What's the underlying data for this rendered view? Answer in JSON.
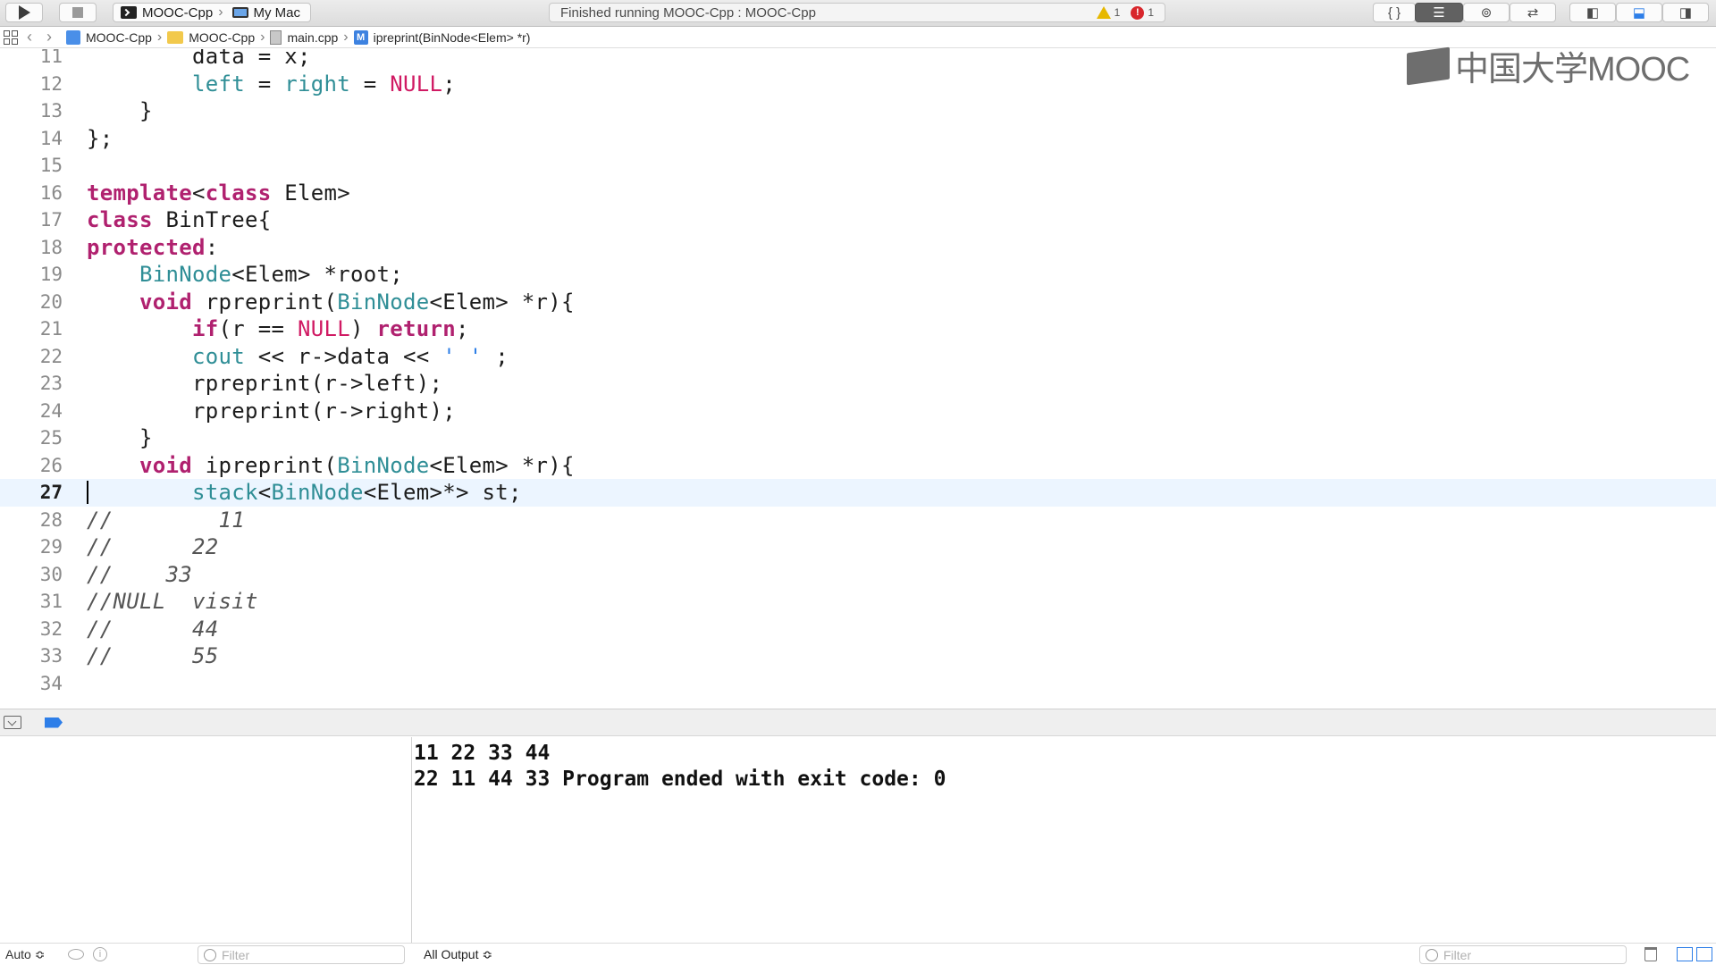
{
  "toolbar": {
    "scheme_target": "MOOC-Cpp",
    "scheme_device": "My Mac",
    "activity_status": "Finished running MOOC-Cpp : MOOC-Cpp",
    "warning_count": "1",
    "error_count": "1",
    "brace_label": "{ }",
    "warning_color": "#e6b800",
    "error_color": "#d8262c"
  },
  "jumpbar": {
    "crumbs": [
      "MOOC-Cpp",
      "MOOC-Cpp",
      "main.cpp",
      "ipreprint(BinNode<Elem> *r)"
    ]
  },
  "watermark": {
    "text": "中国大学MOOC"
  },
  "editor": {
    "current_line": "27",
    "lines": [
      {
        "n": "11",
        "t": [
          {
            "c": "        data = x;",
            "k": "id"
          }
        ]
      },
      {
        "n": "12",
        "t": [
          {
            "c": "        ",
            "k": "id"
          },
          {
            "c": "left",
            "k": "ty"
          },
          {
            "c": " = ",
            "k": "id"
          },
          {
            "c": "right",
            "k": "ty"
          },
          {
            "c": " = ",
            "k": "id"
          },
          {
            "c": "NULL",
            "k": "mac"
          },
          {
            "c": ";",
            "k": "id"
          }
        ]
      },
      {
        "n": "13",
        "t": [
          {
            "c": "    }",
            "k": "id"
          }
        ]
      },
      {
        "n": "14",
        "t": [
          {
            "c": "};",
            "k": "id"
          }
        ]
      },
      {
        "n": "15",
        "t": [
          {
            "c": "",
            "k": "id"
          }
        ]
      },
      {
        "n": "16",
        "t": [
          {
            "c": "template",
            "k": "kw"
          },
          {
            "c": "<",
            "k": "id"
          },
          {
            "c": "class",
            "k": "kw"
          },
          {
            "c": " Elem>",
            "k": "id"
          }
        ]
      },
      {
        "n": "17",
        "t": [
          {
            "c": "class",
            "k": "kw"
          },
          {
            "c": " BinTree{",
            "k": "id"
          }
        ]
      },
      {
        "n": "18",
        "t": [
          {
            "c": "protected",
            "k": "kw"
          },
          {
            "c": ":",
            "k": "id"
          }
        ]
      },
      {
        "n": "19",
        "t": [
          {
            "c": "    ",
            "k": "id"
          },
          {
            "c": "BinNode",
            "k": "ty"
          },
          {
            "c": "<Elem> *root;",
            "k": "id"
          }
        ]
      },
      {
        "n": "20",
        "t": [
          {
            "c": "    ",
            "k": "id"
          },
          {
            "c": "void",
            "k": "kw"
          },
          {
            "c": " rpreprint(",
            "k": "id"
          },
          {
            "c": "BinNode",
            "k": "ty"
          },
          {
            "c": "<Elem> *r){",
            "k": "id"
          }
        ]
      },
      {
        "n": "21",
        "t": [
          {
            "c": "        ",
            "k": "id"
          },
          {
            "c": "if",
            "k": "kw"
          },
          {
            "c": "(r == ",
            "k": "id"
          },
          {
            "c": "NULL",
            "k": "mac"
          },
          {
            "c": ") ",
            "k": "id"
          },
          {
            "c": "return",
            "k": "kw"
          },
          {
            "c": ";",
            "k": "id"
          }
        ]
      },
      {
        "n": "22",
        "t": [
          {
            "c": "        ",
            "k": "id"
          },
          {
            "c": "cout",
            "k": "ty"
          },
          {
            "c": " << r->data << ",
            "k": "id"
          },
          {
            "c": "' '",
            "k": "str"
          },
          {
            "c": " ;",
            "k": "id"
          }
        ]
      },
      {
        "n": "23",
        "t": [
          {
            "c": "        rpreprint(r->left);",
            "k": "id"
          }
        ]
      },
      {
        "n": "24",
        "t": [
          {
            "c": "        rpreprint(r->right);",
            "k": "id"
          }
        ]
      },
      {
        "n": "25",
        "t": [
          {
            "c": "    }",
            "k": "id"
          }
        ]
      },
      {
        "n": "26",
        "t": [
          {
            "c": "    ",
            "k": "id"
          },
          {
            "c": "void",
            "k": "kw"
          },
          {
            "c": " ipreprint(",
            "k": "id"
          },
          {
            "c": "BinNode",
            "k": "ty"
          },
          {
            "c": "<Elem> *r){",
            "k": "id"
          }
        ]
      },
      {
        "n": "27",
        "t": [
          {
            "c": "        ",
            "k": "id"
          },
          {
            "c": "stack",
            "k": "ty"
          },
          {
            "c": "<",
            "k": "id"
          },
          {
            "c": "BinNode",
            "k": "ty"
          },
          {
            "c": "<Elem>*> st;",
            "k": "id"
          }
        ]
      },
      {
        "n": "28",
        "t": [
          {
            "c": "//        11",
            "k": "cm"
          }
        ]
      },
      {
        "n": "29",
        "t": [
          {
            "c": "//      22",
            "k": "cm"
          }
        ]
      },
      {
        "n": "30",
        "t": [
          {
            "c": "//    33",
            "k": "cm"
          }
        ]
      },
      {
        "n": "31",
        "t": [
          {
            "c": "//NULL  visit",
            "k": "cm"
          }
        ]
      },
      {
        "n": "32",
        "t": [
          {
            "c": "//      44",
            "k": "cm"
          }
        ]
      },
      {
        "n": "33",
        "t": [
          {
            "c": "//      55",
            "k": "cm"
          }
        ]
      },
      {
        "n": "34",
        "t": [
          {
            "c": "",
            "k": "id"
          }
        ]
      }
    ]
  },
  "console": {
    "lines": [
      "11 22 33 44",
      "22 11 44 33 Program ended with exit code: 0"
    ]
  },
  "bottom": {
    "auto_label": "Auto ≎",
    "filter_placeholder": "Filter",
    "output_label": "All Output ≎",
    "filter2_placeholder": "Filter"
  }
}
